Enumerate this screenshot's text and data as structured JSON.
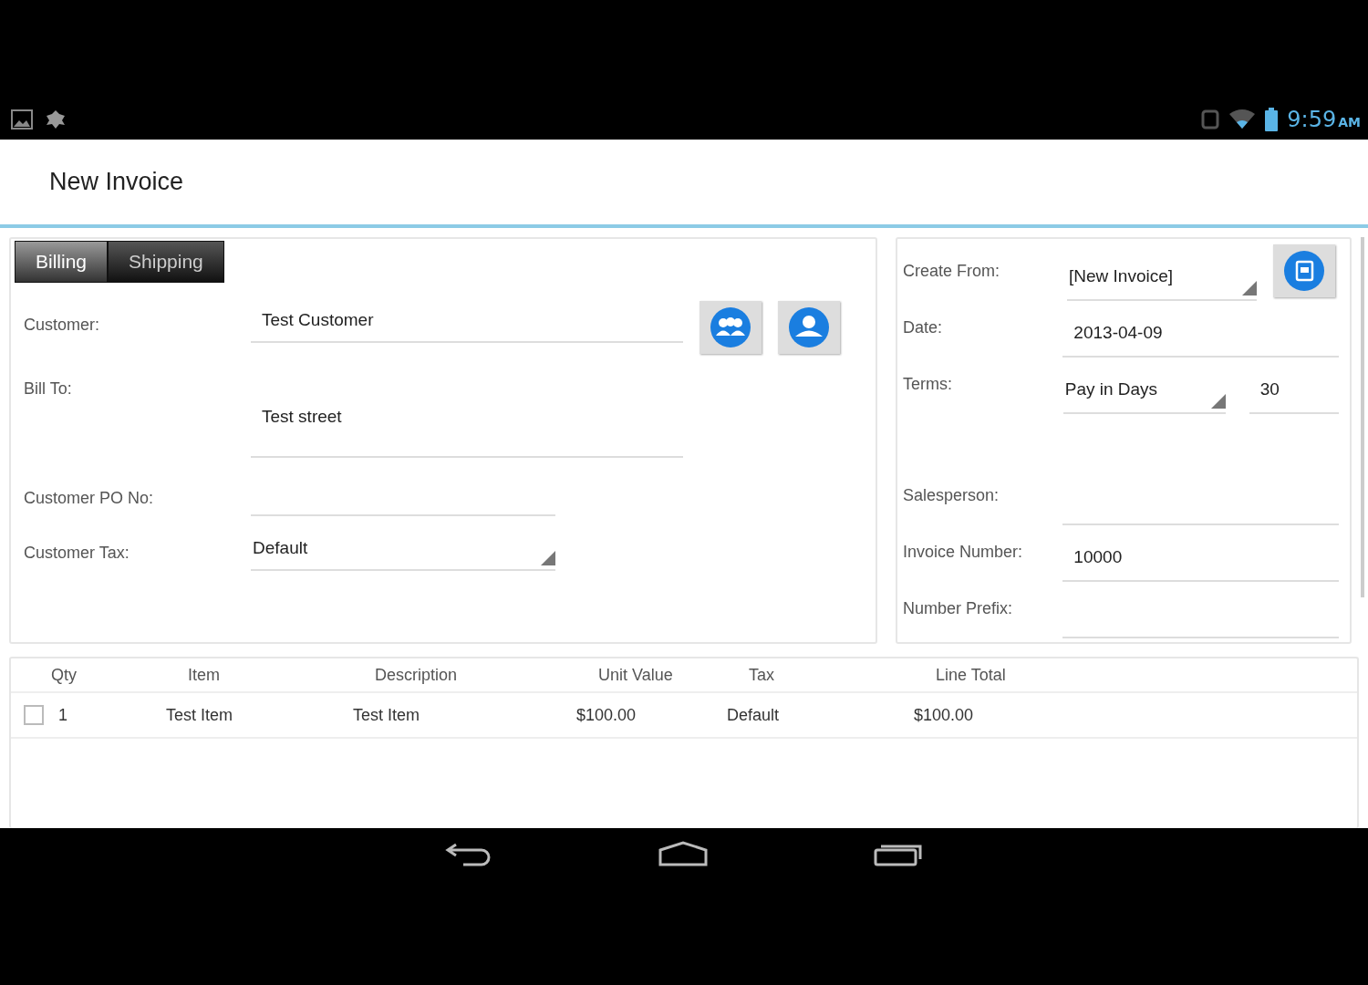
{
  "status_bar": {
    "time": "9:59",
    "meridiem": "AM"
  },
  "title": "New Invoice",
  "tabs": [
    {
      "label": "Billing",
      "selected": true
    },
    {
      "label": "Shipping",
      "selected": false
    }
  ],
  "billing_fields": [
    {
      "kind": "text",
      "label": "Customer:",
      "value": "Test Customer",
      "actions": [
        {
          "kind": "people"
        },
        {
          "kind": "person"
        }
      ]
    },
    {
      "kind": "multiline",
      "label": "Bill To:",
      "value": "Test street"
    },
    {
      "kind": "short",
      "label": "Customer PO No:"
    },
    {
      "kind": "dropdown",
      "label": "Customer Tax:",
      "value": "Default"
    }
  ],
  "invoice_fields": [
    {
      "kind": "dropdown",
      "label": "Create From:",
      "value": "[New Invoice]"
    },
    {
      "kind": "text",
      "label": "Date:",
      "value": "2013-04-09"
    },
    {
      "kind": "terms",
      "label": "Terms:",
      "value": "Pay in Days",
      "days": "30"
    },
    {
      "kind": "text",
      "label": "Salesperson:"
    },
    {
      "kind": "text",
      "label": "Invoice Number:",
      "value": "10000"
    },
    {
      "kind": "text",
      "label": "Number Prefix:"
    }
  ],
  "table": {
    "columns": [
      "Qty",
      "Item",
      "Description",
      "Unit Value",
      "Tax",
      "Line Total"
    ],
    "rows": [
      {
        "checked": false,
        "cells": [
          "1",
          "Test Item",
          "Test Item",
          "$100.00",
          "Default",
          "$100.00"
        ]
      }
    ]
  }
}
